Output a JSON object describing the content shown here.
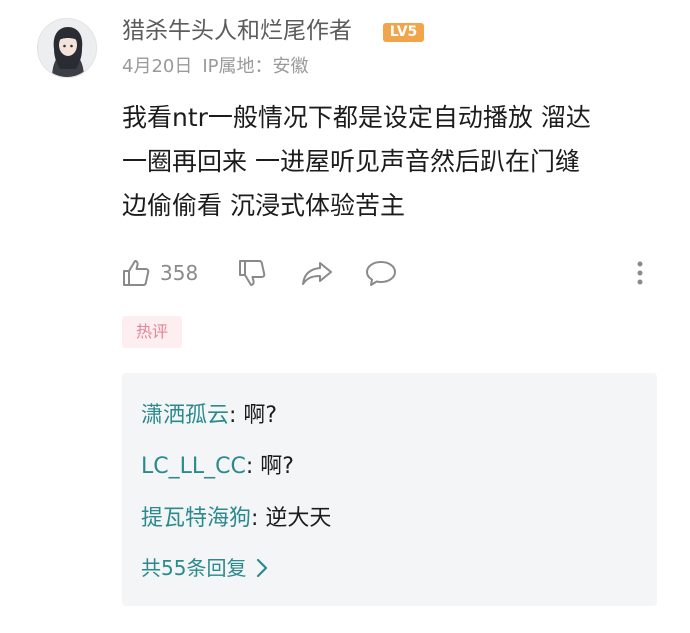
{
  "comment": {
    "user": {
      "name": "猎杀牛头人和烂尾作者",
      "level": "LV5"
    },
    "date": "4月20日",
    "ip_location": "IP属地：安徽",
    "text_lines": [
      "我看ntr一般情况下都是设定自动播放 溜达",
      "一圈再回来 一进屋听见声音然后趴在门缝",
      "边偷偷看 沉浸式体验苦主"
    ],
    "likes": "358",
    "tag": "热评",
    "actions": {
      "like_icon": "thumb-up-icon",
      "dislike_icon": "thumb-down-icon",
      "share_icon": "share-icon",
      "reply_icon": "comment-icon",
      "more_icon": "more-vertical-icon"
    }
  },
  "replies": [
    {
      "name": "潇洒孤云",
      "separator": ": ",
      "text": "啊?"
    },
    {
      "name": "LC_LL_CC",
      "separator": ": ",
      "text": "啊?"
    },
    {
      "name": "提瓦特海狗",
      "separator": ": ",
      "text": "逆大天"
    }
  ],
  "more_replies": "共55条回复",
  "colors": {
    "reply_name": "#2b8a8e",
    "level_badge": "#f2a44a",
    "hot_tag_bg": "#fdeef0",
    "hot_tag_text": "#e58497",
    "reply_box_bg": "#f4f5f6"
  }
}
